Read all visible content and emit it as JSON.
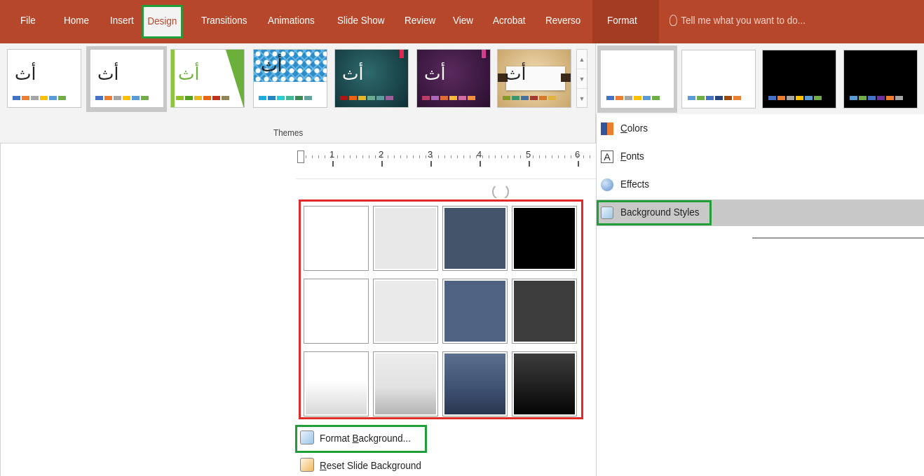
{
  "ribbon_tabs": [
    "File",
    "Home",
    "Insert",
    "Design",
    "Transitions",
    "Animations",
    "Slide Show",
    "Review",
    "View",
    "Acrobat",
    "Reverso"
  ],
  "format_tab": "Format",
  "tell_me": "Tell me what you want to do...",
  "themes": {
    "group_label": "Themes",
    "thumb_glyph": "أث"
  },
  "background_menu": {
    "format_background": {
      "prefix": "Format ",
      "accel": "B",
      "rest": "ackground..."
    },
    "reset_background": {
      "accel": "R",
      "rest": "eset Slide Background"
    }
  },
  "variants_menu": {
    "colors": {
      "accel": "C",
      "rest": "olors"
    },
    "fonts": {
      "accel": "F",
      "rest": "onts"
    },
    "effects": "Effects",
    "background_styles": "Background Styles"
  },
  "ruler_numbers": [
    "1",
    "2",
    "3",
    "4",
    "5",
    "6"
  ],
  "colors": {
    "ribbon_accent": "#b7472a",
    "highlight_green": "#1f9e3a",
    "highlight_red": "#e12b2b"
  }
}
